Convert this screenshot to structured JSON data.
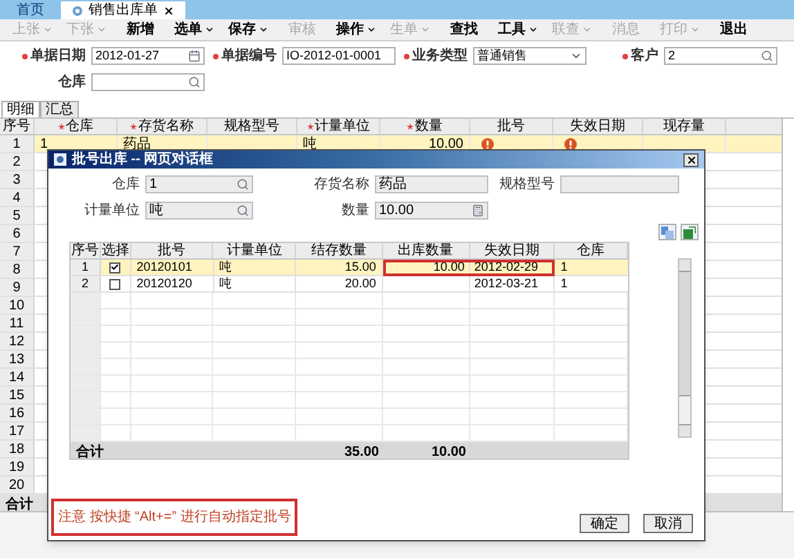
{
  "tabs": [
    {
      "label": "首页",
      "selected": false,
      "closable": false
    },
    {
      "label": "销售出库单",
      "selected": true,
      "closable": true
    }
  ],
  "toolbar": [
    {
      "label": "上张",
      "menu": true,
      "disabled": true
    },
    {
      "label": "下张",
      "menu": true,
      "disabled": true
    },
    {
      "label": "新增",
      "menu": false,
      "disabled": false
    },
    {
      "label": "选单",
      "menu": true,
      "disabled": false
    },
    {
      "label": "保存",
      "menu": true,
      "disabled": false
    },
    {
      "label": "审核",
      "menu": false,
      "disabled": true
    },
    {
      "label": "操作",
      "menu": true,
      "disabled": false
    },
    {
      "label": "生单",
      "menu": true,
      "disabled": true
    },
    {
      "label": "查找",
      "menu": false,
      "disabled": false
    },
    {
      "label": "工具",
      "menu": true,
      "disabled": false
    },
    {
      "label": "联查",
      "menu": true,
      "disabled": true
    },
    {
      "label": "消息",
      "menu": false,
      "disabled": true
    },
    {
      "label": "打印",
      "menu": true,
      "disabled": true
    },
    {
      "label": "退出",
      "menu": false,
      "disabled": false
    }
  ],
  "form_rows": [
    [
      {
        "label": "单据日期",
        "value": "2012-01-27",
        "required": true,
        "kind": "date"
      },
      {
        "label": "单据编号",
        "value": "IO-2012-01-0001",
        "required": true,
        "kind": "text"
      },
      {
        "label": "业务类型",
        "value": "普通销售",
        "required": true,
        "kind": "select"
      },
      {
        "label": "客户",
        "value": "2",
        "required": true,
        "kind": "search"
      }
    ],
    [
      {
        "label": "仓库",
        "required": false,
        "kind": "search"
      }
    ]
  ],
  "detail_tabs": [
    {
      "label": "明细",
      "selected": true
    },
    {
      "label": "汇总",
      "selected": false
    }
  ],
  "grid": {
    "columns": [
      {
        "label": "序号",
        "required": false
      },
      {
        "label": "仓库",
        "required": true
      },
      {
        "label": "存货名称",
        "required": true
      },
      {
        "label": "规格型号",
        "required": false
      },
      {
        "label": "计量单位",
        "required": true
      },
      {
        "label": "数量",
        "required": true
      },
      {
        "label": "批号",
        "required": false
      },
      {
        "label": "失效日期",
        "required": false
      },
      {
        "label": "现存量",
        "required": false
      }
    ],
    "rows": [
      {
        "no": "1",
        "selected": true,
        "cells": [
          {
            "value": "1",
            "warning": false
          },
          {
            "value": "药品",
            "warning": false
          },
          {
            "warning": false
          },
          {
            "value": "吨",
            "warning": false
          },
          {
            "value": "10.00",
            "warning": false
          },
          {
            "warning": true
          },
          {
            "warning": true
          },
          {
            "warning": false
          }
        ]
      },
      {
        "no": "2",
        "selected": false
      },
      {
        "no": "3",
        "selected": false
      },
      {
        "no": "4",
        "selected": false
      },
      {
        "no": "5",
        "selected": false
      },
      {
        "no": "6",
        "selected": false
      },
      {
        "no": "7",
        "selected": false
      },
      {
        "no": "8",
        "selected": false
      },
      {
        "no": "9",
        "selected": false
      },
      {
        "no": "10",
        "selected": false
      },
      {
        "no": "11",
        "selected": false
      },
      {
        "no": "12",
        "selected": false
      },
      {
        "no": "13",
        "selected": false
      },
      {
        "no": "14",
        "selected": false
      },
      {
        "no": "15",
        "selected": false
      },
      {
        "no": "16",
        "selected": false
      },
      {
        "no": "17",
        "selected": false
      },
      {
        "no": "18",
        "selected": false
      },
      {
        "no": "19",
        "selected": false
      },
      {
        "no": "20",
        "selected": false
      }
    ],
    "total_label": "合计"
  },
  "dialog": {
    "title": "批号出库 -- 网页对话框",
    "fields": [
      {
        "label": "仓库",
        "value": "1",
        "kind": "search"
      },
      {
        "label": "存货名称",
        "value": "药品",
        "kind": "text"
      },
      {
        "label": "规格型号",
        "kind": "text"
      },
      {
        "label": "计量单位",
        "value": "吨",
        "kind": "search"
      },
      {
        "label": "数量",
        "value": "10.00",
        "kind": "calc"
      }
    ],
    "columns": [
      "序号",
      "选择",
      "批号",
      "计量单位",
      "结存数量",
      "出库数量",
      "失效日期",
      "仓库"
    ],
    "rows": [
      {
        "no": "1",
        "checked": true,
        "selected": true,
        "flagged": true,
        "batch": "20120101",
        "unit": "吨",
        "stock": "15.00",
        "out_qty": "10.00",
        "expiry": "2012-02-29",
        "warehouse": "1"
      },
      {
        "no": "2",
        "checked": false,
        "selected": false,
        "flagged": false,
        "batch": "20120120",
        "unit": "吨",
        "stock": "20.00",
        "expiry": "2012-03-21",
        "warehouse": "1"
      }
    ],
    "total": {
      "label": "合计",
      "stock": "35.00",
      "out_qty": "10.00"
    },
    "note": "注意 按快捷 “Alt+=” 进行自动指定批号",
    "buttons": [
      "确定",
      "取消"
    ]
  }
}
